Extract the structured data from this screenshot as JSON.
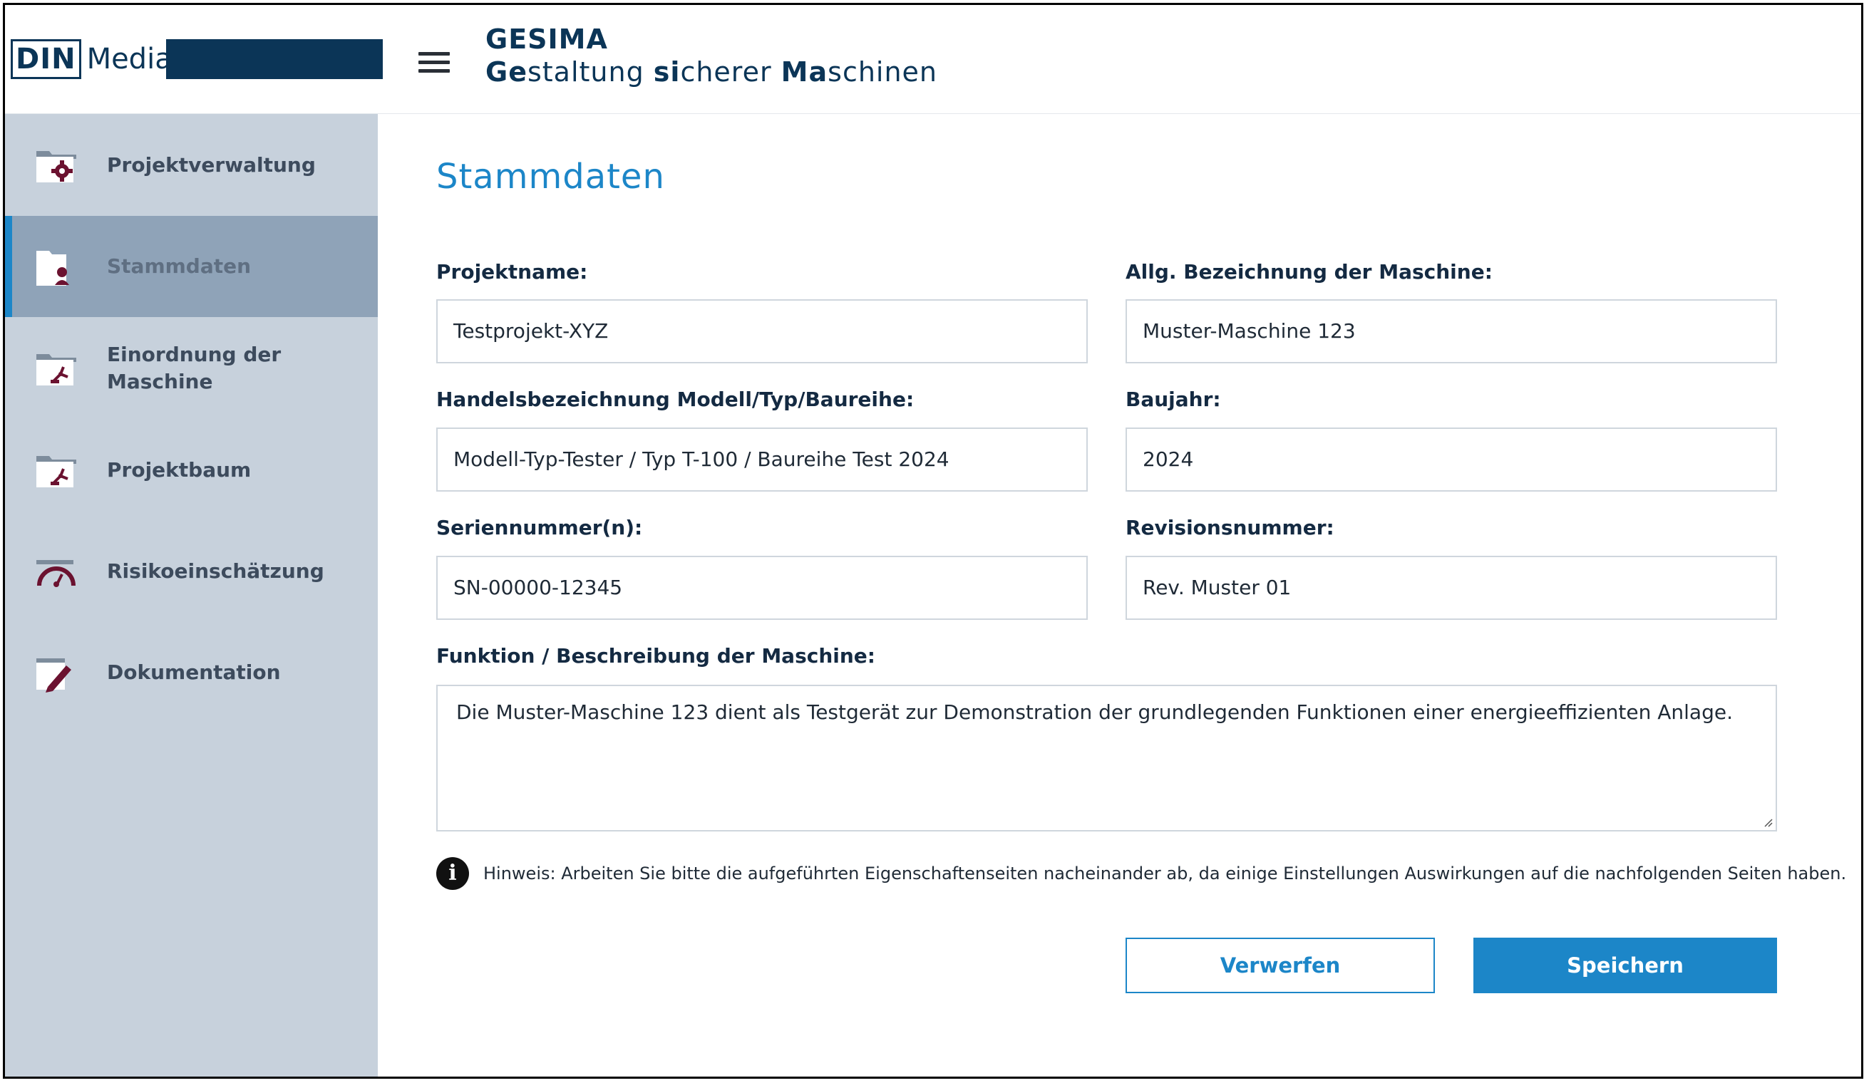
{
  "header": {
    "logo": {
      "din": "DIN",
      "media": "Media"
    },
    "app_name": "GESIMA",
    "app_subtitle_parts": [
      "Ge",
      "staltung ",
      "si",
      "cherer ",
      "Ma",
      "schinen"
    ]
  },
  "sidebar": {
    "items": [
      {
        "label": "Projektverwaltung",
        "icon": "folder-gear-icon",
        "active": false
      },
      {
        "label": "Stammdaten",
        "icon": "folder-user-icon",
        "active": true
      },
      {
        "label": "Einordnung der Maschine",
        "icon": "folder-robot-arm-icon",
        "active": false
      },
      {
        "label": "Projektbaum",
        "icon": "folder-robot-arm-icon",
        "active": false
      },
      {
        "label": "Risikoeinschätzung",
        "icon": "gauge-icon",
        "active": false
      },
      {
        "label": "Dokumentation",
        "icon": "document-pen-icon",
        "active": false
      }
    ]
  },
  "main": {
    "title": "Stammdaten",
    "fields": {
      "projektname": {
        "label": "Projektname:",
        "value": "Testprojekt-XYZ"
      },
      "bezeichnung": {
        "label": "Allg. Bezeichnung der Maschine:",
        "value": "Muster-Maschine 123"
      },
      "handelsbezeichnung": {
        "label": "Handelsbezeichnung Modell/Typ/Baureihe:",
        "value": "Modell-Typ-Tester / Typ T-100 / Baureihe Test 2024"
      },
      "baujahr": {
        "label": "Baujahr:",
        "value": "2024"
      },
      "seriennummer": {
        "label": "Seriennummer(n):",
        "value": "SN-00000-12345"
      },
      "revisionsnummer": {
        "label": "Revisionsnummer:",
        "value": "Rev. Muster 01"
      },
      "funktion": {
        "label": "Funktion / Beschreibung der Maschine:",
        "value": "Die Muster-Maschine 123 dient als Testgerät zur Demonstration der grundlegenden Funktionen einer energieeffizienten Anlage."
      }
    },
    "hint": {
      "icon": "info-icon",
      "text": "Hinweis: Arbeiten Sie bitte die aufgeführten Eigenschaftenseiten nacheinander ab, da einige Einstellungen Auswirkungen auf die nachfolgenden Seiten haben."
    },
    "buttons": {
      "discard": "Verwerfen",
      "save": "Speichern"
    }
  },
  "colors": {
    "accent": "#1c86c8",
    "brand": "#0b3557",
    "sidebar_bg": "#c7d1dc",
    "sidebar_active": "#8fa3b8",
    "icon_maroon": "#6b1230"
  }
}
